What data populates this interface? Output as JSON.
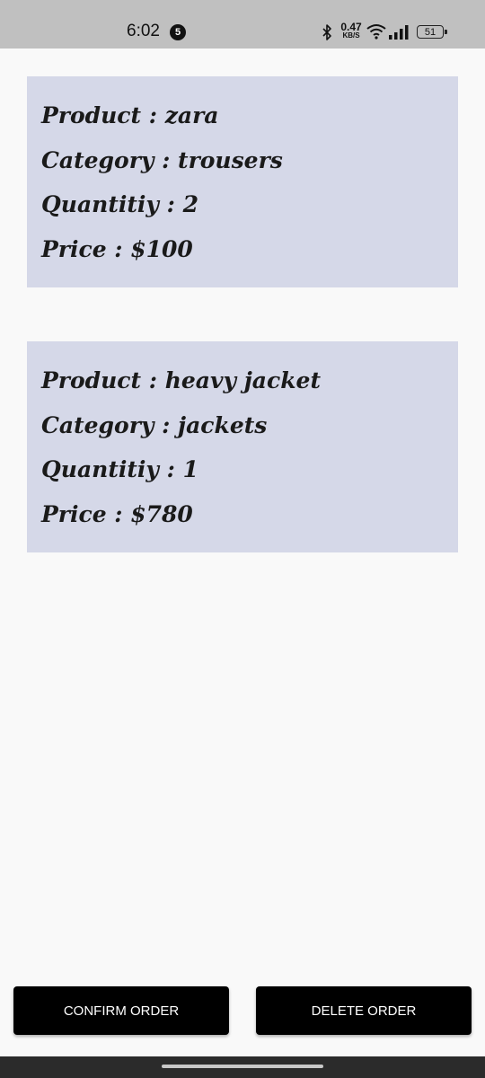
{
  "status_bar": {
    "time": "6:02",
    "notification_count": "5",
    "net_speed_value": "0.47",
    "net_speed_unit": "KB/S",
    "battery": "51",
    "icons": [
      "bluetooth-icon",
      "wifi-icon",
      "signal-icon",
      "battery-icon"
    ]
  },
  "orders": [
    {
      "product": "Product : zara",
      "category": "Category : trousers",
      "quantity": "Quantitiy : 2",
      "price": "Price : $100"
    },
    {
      "product": "Product : heavy jacket",
      "category": "Category : jackets",
      "quantity": "Quantitiy : 1",
      "price": "Price : $780"
    }
  ],
  "actions": {
    "confirm_label": "CONFIRM ORDER",
    "delete_label": "DELETE ORDER"
  },
  "colors": {
    "card_background": "#d5d8e8",
    "button_background": "#000000",
    "status_bar_background": "#c0c0c0"
  }
}
